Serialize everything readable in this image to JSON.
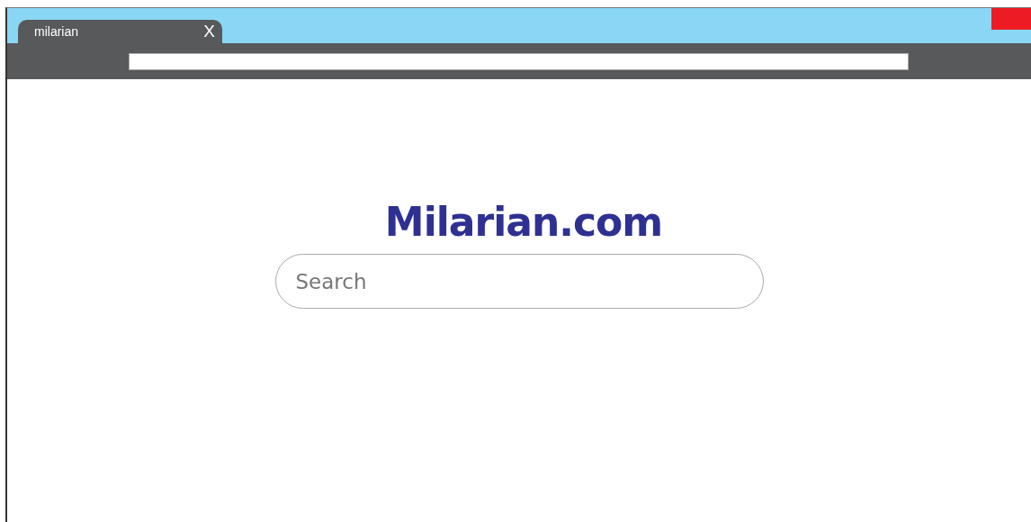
{
  "tabs": [
    {
      "label": "milarian",
      "close": "X"
    }
  ],
  "page": {
    "logo": "Milarian.com",
    "search": {
      "placeholder": "Search"
    }
  }
}
